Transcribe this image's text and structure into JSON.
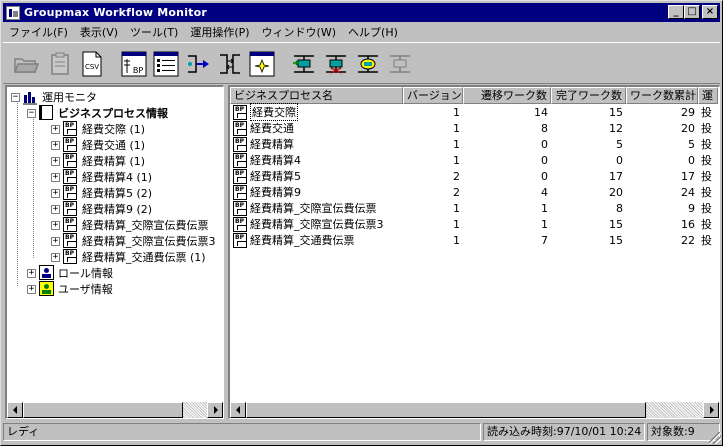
{
  "window": {
    "title": "Groupmax Workflow Monitor",
    "controls": {
      "minimize": "_",
      "maximize": "□",
      "close": "×"
    }
  },
  "menu": [
    {
      "label": "ファイル(F)"
    },
    {
      "label": "表示(V)"
    },
    {
      "label": "ツール(T)"
    },
    {
      "label": "運用操作(P)"
    },
    {
      "label": "ウィンドウ(W)"
    },
    {
      "label": "ヘルプ(H)"
    }
  ],
  "toolbar": {
    "buttons": [
      {
        "icon": "open-folder-icon"
      },
      {
        "icon": "clipboard-icon"
      },
      {
        "icon": "csv-file-icon",
        "label": "CSV"
      },
      {
        "icon": "bp-window-icon",
        "label": "BP"
      },
      {
        "icon": "list-view-icon"
      },
      {
        "icon": "route-icon"
      },
      {
        "icon": "swap-icon"
      },
      {
        "icon": "target-icon"
      },
      {
        "icon": "workflow-start-icon"
      },
      {
        "icon": "workflow-stop-icon"
      },
      {
        "icon": "workflow-refresh-icon"
      },
      {
        "icon": "workflow-disabled-icon"
      }
    ]
  },
  "tree": {
    "root": {
      "label": "運用モニタ",
      "expander": "−"
    },
    "bp_group": {
      "label": "ビジネスプロセス情報",
      "expander": "−"
    },
    "bp_items": [
      {
        "label": "経費交際 (1)",
        "expander": "+"
      },
      {
        "label": "経費交通 (1)",
        "expander": "+"
      },
      {
        "label": "経費精算 (1)",
        "expander": "+"
      },
      {
        "label": "経費精算4 (1)",
        "expander": "+"
      },
      {
        "label": "経費精算5 (2)",
        "expander": "+"
      },
      {
        "label": "経費精算9 (2)",
        "expander": "+"
      },
      {
        "label": "経費精算_交際宣伝費伝票",
        "expander": "+"
      },
      {
        "label": "経費精算_交際宣伝費伝票3",
        "expander": "+"
      },
      {
        "label": "経費精算_交通費伝票 (1)",
        "expander": "+"
      }
    ],
    "role": {
      "label": "ロール情報",
      "expander": "+"
    },
    "user": {
      "label": "ユーザ情報",
      "expander": "+"
    }
  },
  "table": {
    "columns": [
      "ビジネスプロセス名",
      "バージョン",
      "遷移ワーク数",
      "完了ワーク数",
      "ワーク数累計",
      "運"
    ],
    "rows": [
      {
        "name": "経費交際",
        "version": "1",
        "transition": "14",
        "completed": "15",
        "total": "29",
        "status": "投"
      },
      {
        "name": "経費交通",
        "version": "1",
        "transition": "8",
        "completed": "12",
        "total": "20",
        "status": "投"
      },
      {
        "name": "経費精算",
        "version": "1",
        "transition": "0",
        "completed": "5",
        "total": "5",
        "status": "投"
      },
      {
        "name": "経費精算4",
        "version": "1",
        "transition": "0",
        "completed": "0",
        "total": "0",
        "status": "投"
      },
      {
        "name": "経費精算5",
        "version": "2",
        "transition": "0",
        "completed": "17",
        "total": "17",
        "status": "投"
      },
      {
        "name": "経費精算9",
        "version": "2",
        "transition": "4",
        "completed": "20",
        "total": "24",
        "status": "投"
      },
      {
        "name": "経費精算_交際宣伝費伝票",
        "version": "1",
        "transition": "1",
        "completed": "8",
        "total": "9",
        "status": "投"
      },
      {
        "name": "経費精算_交際宣伝費伝票3",
        "version": "1",
        "transition": "1",
        "completed": "15",
        "total": "16",
        "status": "投"
      },
      {
        "name": "経費精算_交通費伝票",
        "version": "1",
        "transition": "7",
        "completed": "15",
        "total": "22",
        "status": "投"
      }
    ]
  },
  "status": {
    "ready": "レディ",
    "loaded_time": "読み込み時刻:97/10/01 10:24",
    "object_count": "対象数:9"
  },
  "colors": {
    "titlebar": "#000080",
    "face": "#c0c0c0",
    "window_bg": "#ffffff"
  }
}
